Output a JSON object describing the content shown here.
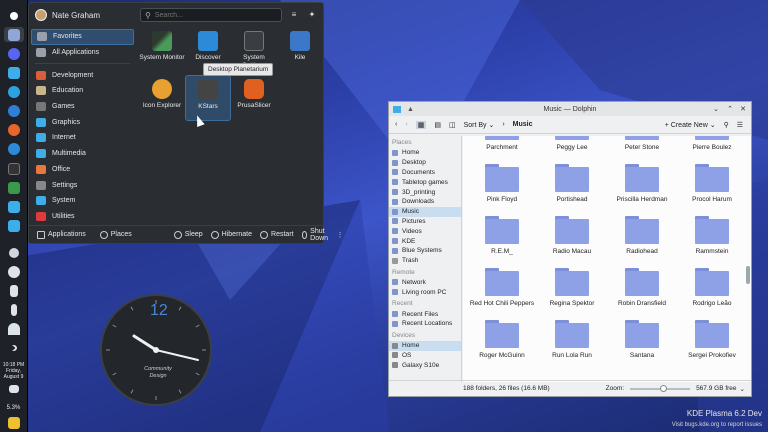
{
  "launcher": {
    "user_name": "Nate Graham",
    "search_placeholder": "Search...",
    "categories": [
      {
        "label": "Favorites",
        "color": "#9aa0aa"
      },
      {
        "label": "All Applications",
        "color": "#9aa0aa"
      },
      {
        "label": "Development",
        "color": "#d95f3b"
      },
      {
        "label": "Education",
        "color": "#c8b58a"
      },
      {
        "label": "Games",
        "color": "#777"
      },
      {
        "label": "Graphics",
        "color": "#3daee9"
      },
      {
        "label": "Internet",
        "color": "#3daee9"
      },
      {
        "label": "Multimedia",
        "color": "#3daee9"
      },
      {
        "label": "Office",
        "color": "#e8793a"
      },
      {
        "label": "Settings",
        "color": "#888"
      },
      {
        "label": "System",
        "color": "#3daee9"
      },
      {
        "label": "Utilities",
        "color": "#e03a3a"
      }
    ],
    "apps": [
      {
        "label": "System Monitor",
        "color": "#4a8a5a"
      },
      {
        "label": "Discover",
        "color": "#2d8ad8"
      },
      {
        "label": "System Settings",
        "color": "#555"
      },
      {
        "label": "Kile",
        "color": "#3c78c8"
      },
      {
        "label": "Icon Explorer",
        "color": "#e8a030"
      },
      {
        "label": "KStars",
        "color": "#444"
      },
      {
        "label": "PrusaSlicer",
        "color": "#e06020"
      }
    ],
    "tooltip": "Desktop Planetarium",
    "footer": {
      "applications": "Applications",
      "places": "Places",
      "sleep": "Sleep",
      "hibernate": "Hibernate",
      "restart": "Restart",
      "shutdown": "Shut Down"
    }
  },
  "panel": {
    "time": "10:18 PM",
    "date_line1": "Friday,",
    "date_line2": "August 9",
    "battery": "5.3%"
  },
  "clock_widget": {
    "numeral": "12",
    "brand": "Community Design"
  },
  "dolphin": {
    "title": "Music — Dolphin",
    "sort_by": "Sort By",
    "breadcrumb": "Music",
    "create_new": "Create New",
    "sidebar": {
      "places_header": "Places",
      "places": [
        "Home",
        "Desktop",
        "Documents",
        "Tabletop games",
        "3D_printing",
        "Downloads",
        "Music",
        "Pictures",
        "Videos",
        "KDE",
        "Blue Systems",
        "Trash"
      ],
      "remote_header": "Remote",
      "remote": [
        "Network",
        "Living room PC"
      ],
      "recent_header": "Recent",
      "recent": [
        "Recent Files",
        "Recent Locations"
      ],
      "devices_header": "Devices",
      "devices": [
        "Home",
        "OS",
        "Galaxy S10e"
      ]
    },
    "folders": [
      "Parchment",
      "Peggy Lee",
      "Peter Stone",
      "Pierre Boulez",
      "Pink Floyd",
      "Portishead",
      "Priscilla Herdman",
      "Procol Harum",
      "R.E.M_",
      "Radio Macau",
      "Radiohead",
      "Rammstein",
      "Red Hot Chili Peppers",
      "Regina Spektor",
      "Robin Dransfield",
      "Rodrigo Leão",
      "Roger McGuinn",
      "Run Lola Run",
      "Santana",
      "Sergei Prokofiev"
    ],
    "status_text": "188 folders, 26 files (16.6 MB)",
    "zoom_label": "Zoom:",
    "free_space": "567.9 GB free"
  },
  "desktop": {
    "version": "KDE Plasma 6.2 Dev",
    "bug_text": "Visit bugs.kde.org to report issues"
  }
}
